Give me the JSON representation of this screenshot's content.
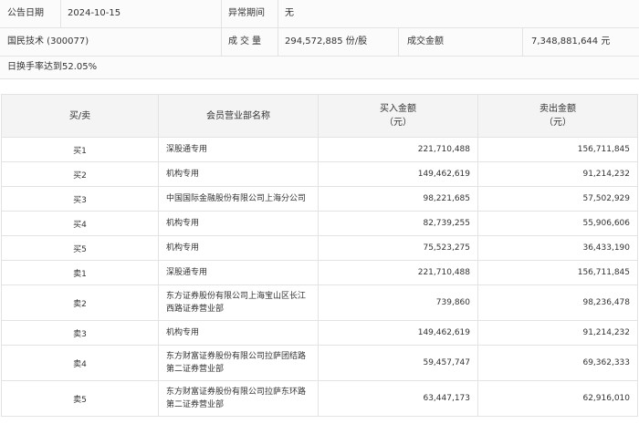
{
  "summary": {
    "announce_date_label": "公告日期",
    "announce_date": "2024-10-15",
    "abnormal_period_label": "异常期间",
    "abnormal_period": "无",
    "stock_name": "国民技术 (300077)",
    "volume_label": "成交量",
    "volume": "294,572,885 份/股",
    "amount_label": "成交金额",
    "amount": "7,348,881,644 元",
    "turnover_note": "日换手率达到52.05%"
  },
  "table": {
    "headers": {
      "side": "买/卖",
      "dept": "会员营业部名称",
      "buy_line1": "买入金额",
      "buy_line2": "（元）",
      "sell_line1": "卖出金额",
      "sell_line2": "（元）"
    },
    "rows": [
      {
        "side": "买1",
        "dept_line1": "深股通专用",
        "dept_line2": "",
        "buy": "221,710,488",
        "sell": "156,711,845"
      },
      {
        "side": "买2",
        "dept_line1": "机构专用",
        "dept_line2": "",
        "buy": "149,462,619",
        "sell": "91,214,232"
      },
      {
        "side": "买3",
        "dept_line1": "中国国际金融股份有限公司上海分公司",
        "dept_line2": "",
        "buy": "98,221,685",
        "sell": "57,502,929"
      },
      {
        "side": "买4",
        "dept_line1": "机构专用",
        "dept_line2": "",
        "buy": "82,739,255",
        "sell": "55,906,606"
      },
      {
        "side": "买5",
        "dept_line1": "机构专用",
        "dept_line2": "",
        "buy": "75,523,275",
        "sell": "36,433,190"
      },
      {
        "side": "卖1",
        "dept_line1": "深股通专用",
        "dept_line2": "",
        "buy": "221,710,488",
        "sell": "156,711,845"
      },
      {
        "side": "卖2",
        "dept_line1": "东方证券股份有限公司上海宝山区长江",
        "dept_line2": "西路证券营业部",
        "buy": "739,860",
        "sell": "98,236,478"
      },
      {
        "side": "卖3",
        "dept_line1": "机构专用",
        "dept_line2": "",
        "buy": "149,462,619",
        "sell": "91,214,232"
      },
      {
        "side": "卖4",
        "dept_line1": "东方财富证券股份有限公司拉萨团结路",
        "dept_line2": "第二证券营业部",
        "buy": "59,457,747",
        "sell": "69,362,333"
      },
      {
        "side": "卖5",
        "dept_line1": "东方财富证券股份有限公司拉萨东环路",
        "dept_line2": "第二证券营业部",
        "buy": "63,447,173",
        "sell": "62,916,010"
      }
    ]
  }
}
